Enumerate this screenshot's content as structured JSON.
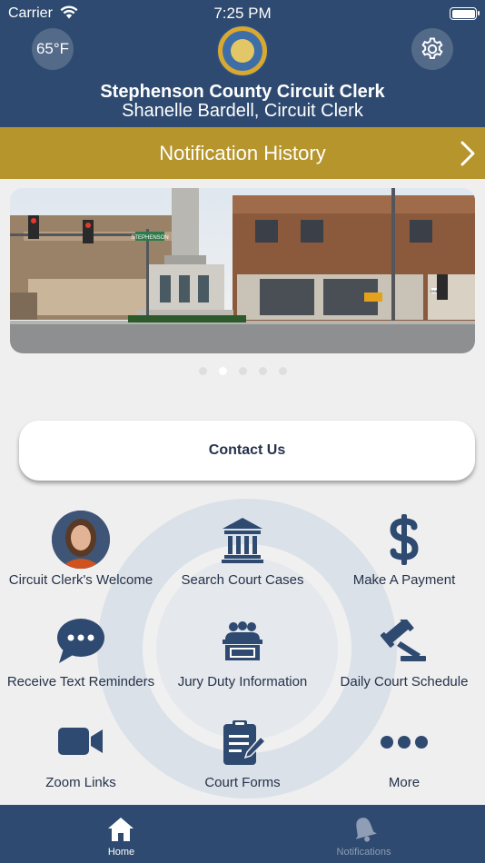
{
  "status_bar": {
    "carrier": "Carrier",
    "time": "7:25 PM"
  },
  "header": {
    "temperature": "65°F",
    "title": "Stephenson County Circuit Clerk",
    "subtitle": "Shanelle Bardell, Circuit Clerk"
  },
  "notification_bar": {
    "label": "Notification History"
  },
  "carousel": {
    "street_sign": "STEPHENSON",
    "one_way_sign": "ONE WAY",
    "slide_count": 5,
    "active_slide": 2
  },
  "contact": {
    "label": "Contact Us"
  },
  "grid": [
    {
      "label": "Circuit Clerk's Welcome",
      "icon": "clerk-photo"
    },
    {
      "label": "Search Court Cases",
      "icon": "courthouse-icon"
    },
    {
      "label": "Make A Payment",
      "icon": "dollar-icon"
    },
    {
      "label": "Receive Text Reminders",
      "icon": "chat-bubble-icon"
    },
    {
      "label": "Jury Duty Information",
      "icon": "jury-box-icon"
    },
    {
      "label": "Daily Court Schedule",
      "icon": "gavel-icon"
    },
    {
      "label": "Zoom Links",
      "icon": "video-camera-icon"
    },
    {
      "label": "Court Forms",
      "icon": "clipboard-icon"
    },
    {
      "label": "More",
      "icon": "more-dots-icon"
    }
  ],
  "tabbar": {
    "home": {
      "label": "Home",
      "active": true
    },
    "notifications": {
      "label": "Notifications",
      "active": false
    }
  },
  "colors": {
    "primary": "#2e4a70",
    "accent_gold": "#b6952d",
    "icon_navy": "#2e4a70",
    "background": "#efefef"
  }
}
